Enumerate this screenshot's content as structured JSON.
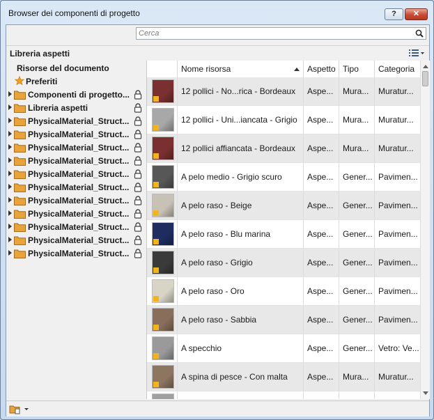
{
  "window": {
    "title": "Browser dei componenti di progetto",
    "help_label": "?",
    "close_label": "✕"
  },
  "search": {
    "placeholder": "Cerca"
  },
  "library_header": {
    "title": "Libreria aspetti"
  },
  "tree": {
    "root": "Risorse del documento",
    "favorites": "Preferiti",
    "items": [
      "Componenti di progetto...",
      "Libreria aspetti",
      "PhysicalMaterial_Struct...",
      "PhysicalMaterial_Struct...",
      "PhysicalMaterial_Struct...",
      "PhysicalMaterial_Struct...",
      "PhysicalMaterial_Struct...",
      "PhysicalMaterial_Struct...",
      "PhysicalMaterial_Struct...",
      "PhysicalMaterial_Struct...",
      "PhysicalMaterial_Struct...",
      "PhysicalMaterial_Struct...",
      "PhysicalMaterial_Struct..."
    ]
  },
  "grid": {
    "columns": [
      "Nome risorsa",
      "Aspetto",
      "Tipo",
      "Categoria"
    ],
    "rows": [
      {
        "name": "12 pollici - No...rica - Bordeaux",
        "aspect": "Aspe...",
        "type": "Mura...",
        "category": "Muratur...",
        "swatch": "#7a3030"
      },
      {
        "name": "12 pollici - Uni...iancata - Grigio",
        "aspect": "Aspe...",
        "type": "Mura...",
        "category": "Muratur...",
        "swatch": "#a8a8a8"
      },
      {
        "name": "12 pollici affiancata - Bordeaux",
        "aspect": "Aspe...",
        "type": "Mura...",
        "category": "Muratur...",
        "swatch": "#7a3030"
      },
      {
        "name": "A pelo medio - Grigio scuro",
        "aspect": "Aspe...",
        "type": "Gener...",
        "category": "Pavimen...",
        "swatch": "#575757"
      },
      {
        "name": "A pelo raso - Beige",
        "aspect": "Aspe...",
        "type": "Gener...",
        "category": "Pavimen...",
        "swatch": "#c8c2b6"
      },
      {
        "name": "A pelo raso - Blu marina",
        "aspect": "Aspe...",
        "type": "Gener...",
        "category": "Pavimen...",
        "swatch": "#1e2c60"
      },
      {
        "name": "A pelo raso - Grigio",
        "aspect": "Aspe...",
        "type": "Gener...",
        "category": "Pavimen...",
        "swatch": "#3a3a3a"
      },
      {
        "name": "A pelo raso - Oro",
        "aspect": "Aspe...",
        "type": "Gener...",
        "category": "Pavimen...",
        "swatch": "#d8d4c6"
      },
      {
        "name": "A pelo raso - Sabbia",
        "aspect": "Aspe...",
        "type": "Gener...",
        "category": "Pavimen...",
        "swatch": "#8a6e5c"
      },
      {
        "name": "A specchio",
        "aspect": "Aspe...",
        "type": "Gener...",
        "category": "Vetro: Ve...",
        "swatch": "#9a9a9a"
      },
      {
        "name": "A spina di pesce - Con malta",
        "aspect": "Aspe...",
        "type": "Mura...",
        "category": "Muratur...",
        "swatch": "#8c7662"
      },
      {
        "name": "",
        "aspect": "",
        "type": "",
        "category": "",
        "swatch": "#a0a0a0"
      }
    ]
  },
  "colors": {
    "warning": "#f2b31b",
    "folder": "#e8a33b",
    "star": "#f0a020"
  }
}
